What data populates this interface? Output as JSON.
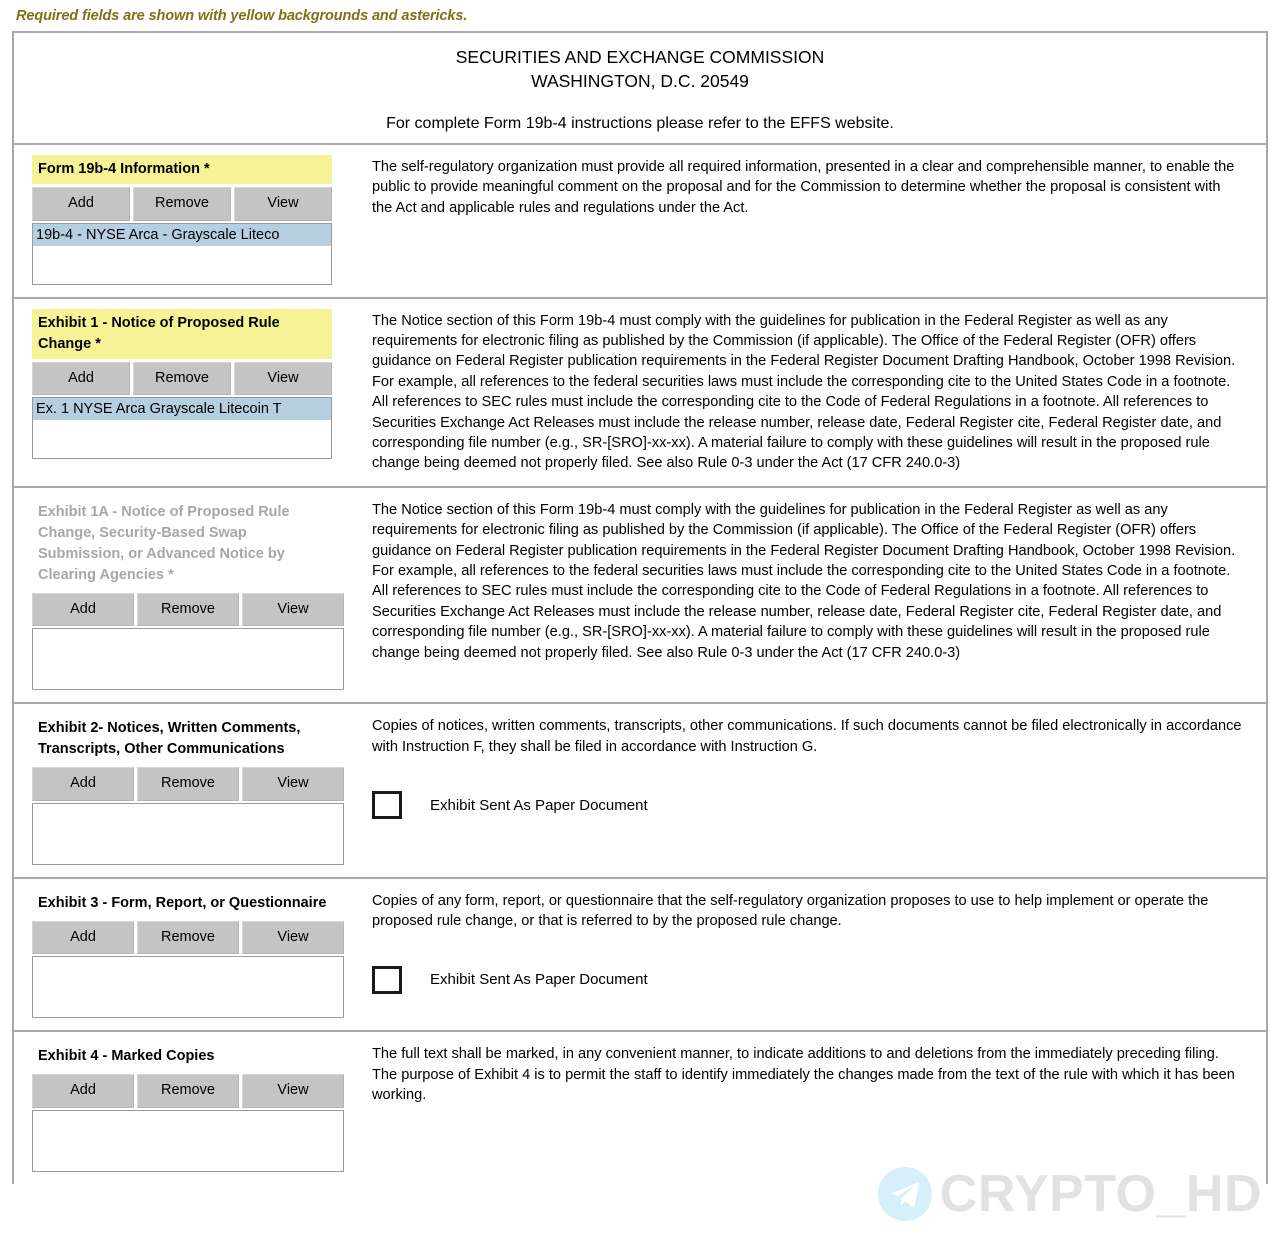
{
  "notice": {
    "required_fields_text": "Required fields are shown with yellow backgrounds and astericks."
  },
  "header": {
    "agency_line1": "SECURITIES AND EXCHANGE COMMISSION",
    "agency_line2": "WASHINGTON, D.C. 20549",
    "instructions_line": "For complete Form 19b-4 instructions please refer to the EFFS website."
  },
  "buttons": {
    "add": "Add",
    "remove": "Remove",
    "view": "View"
  },
  "checkbox_label": "Exhibit Sent As Paper Document",
  "sections": {
    "form19b4": {
      "label": "Form 19b-4 Information *",
      "list_item": "19b-4 - NYSE Arca - Grayscale Liteco",
      "description": "The self-regulatory organization must provide all required information, presented in a clear and comprehensible manner, to enable the public to provide meaningful comment on the proposal and for the Commission to determine whether the proposal is consistent with the Act and applicable rules and regulations under the Act."
    },
    "exhibit1": {
      "label": "Exhibit 1 - Notice of Proposed Rule Change *",
      "list_item": "Ex. 1 NYSE Arca Grayscale Litecoin T",
      "description": "The Notice section of this Form 19b-4 must comply with the guidelines for publication in the Federal Register as well as any requirements for electronic filing as published by the Commission (if applicable).  The Office of the Federal Register (OFR) offers guidance on Federal Register publication requirements in the Federal Register Document Drafting Handbook, October 1998 Revision.  For example, all references to the federal securities laws must include the corresponding cite to the United States Code in a footnote.  All references to SEC rules must include the corresponding cite to the Code of Federal Regulations in a footnote.  All references to Securities Exchange Act Releases must include the release number, release date, Federal Register cite, Federal Register date, and corresponding file number (e.g., SR-[SRO]-xx-xx).  A material failure to comply with these guidelines will result in the proposed rule change being deemed not properly filed.  See also Rule 0-3 under the Act (17 CFR 240.0-3)"
    },
    "exhibit1a": {
      "label": "Exhibit 1A - Notice of Proposed Rule Change, Security-Based Swap Submission, or Advanced Notice by Clearing Agencies *",
      "list_item": "",
      "description": "The Notice section of this Form 19b-4 must comply with the guidelines for publication in the Federal Register as well as any requirements for electronic filing as published by the Commission (if applicable).  The Office of the Federal Register (OFR) offers guidance on Federal Register publication requirements in the Federal Register Document Drafting Handbook, October 1998 Revision.  For example, all references to the federal securities laws must include the corresponding cite to the United States Code in a footnote.  All references to SEC rules must include the corresponding cite to the Code of Federal Regulations in a footnote.  All references to Securities Exchange Act Releases must include the release number, release date, Federal Register cite, Federal Register date, and corresponding file number (e.g., SR-[SRO]-xx-xx).  A material failure to comply with these guidelines will result in the proposed rule change being deemed not properly filed.  See also Rule 0-3 under the Act (17 CFR 240.0-3)"
    },
    "exhibit2": {
      "label": "Exhibit 2- Notices, Written Comments, Transcripts, Other Communications",
      "list_item": "",
      "description": "Copies of notices, written comments, transcripts, other communications. If such documents cannot be filed electronically in accordance with Instruction F, they shall be filed in accordance with Instruction G."
    },
    "exhibit3": {
      "label": "Exhibit 3 - Form, Report, or Questionnaire",
      "list_item": "",
      "description": "Copies of any form, report, or questionnaire that the self-regulatory organization proposes to use to help implement or operate the proposed rule change, or that is referred to by the proposed rule change."
    },
    "exhibit4": {
      "label": "Exhibit 4 - Marked Copies",
      "list_item": "",
      "description": "The full text shall be marked, in any convenient manner, to indicate additions to and deletions from the immediately preceding filing.  The purpose of Exhibit 4 is to permit the staff to identify immediately the changes made from the text of the rule with which it has been working."
    }
  },
  "watermark": {
    "text": "CRYPTO_HD",
    "icon": "telegram-icon"
  },
  "colors": {
    "required_background": "#f7f296",
    "notice_text": "#7a7317",
    "button_face": "#c4c4c4",
    "selection": "#b6cfe0",
    "disabled_text": "#a7a7a7"
  }
}
